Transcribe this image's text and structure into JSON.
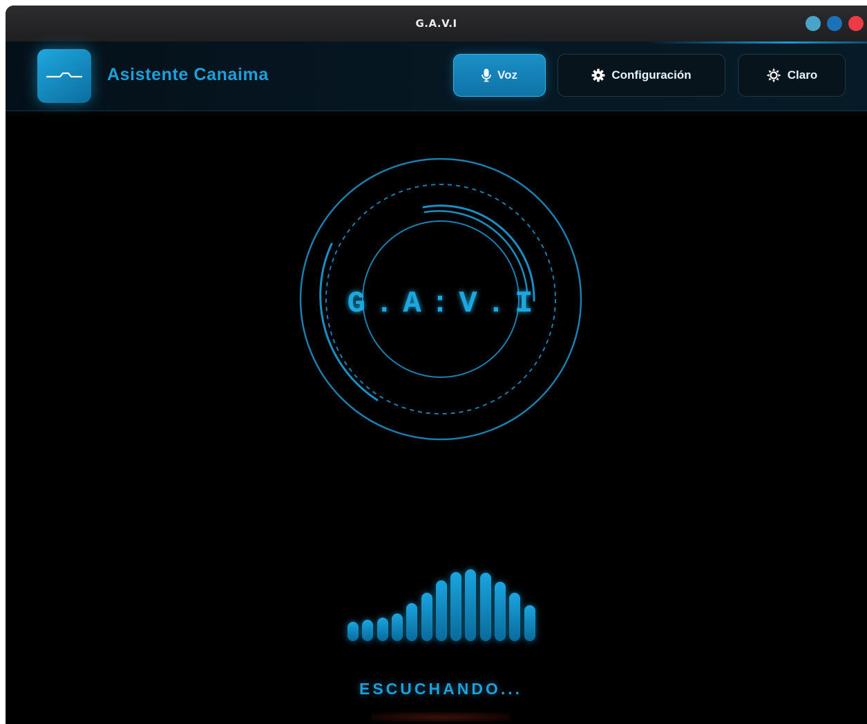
{
  "window": {
    "title": "G.A.V.I",
    "controls": [
      {
        "name": "minimize",
        "color": "#4aa3c9"
      },
      {
        "name": "maximize",
        "color": "#1a72b8"
      },
      {
        "name": "close",
        "color": "#ec3b45"
      }
    ]
  },
  "header": {
    "brand": "Asistente Canaima",
    "buttons": {
      "voice": {
        "label": "Voz",
        "icon": "microphone-icon",
        "active": true
      },
      "settings": {
        "label": "Configuración",
        "icon": "gear-icon",
        "active": false
      },
      "theme": {
        "label": "Claro",
        "icon": "sun-icon",
        "active": false
      }
    }
  },
  "main": {
    "orb_label": "G.A:V.I",
    "status": "ESCUCHANDO...",
    "audio_levels": [
      0.27,
      0.3,
      0.33,
      0.38,
      0.53,
      0.67,
      0.85,
      0.96,
      1.0,
      0.95,
      0.83,
      0.67,
      0.5
    ]
  },
  "theme": {
    "accent": "#1d9fd9",
    "background": "#000000",
    "header_bg": "#061722"
  }
}
